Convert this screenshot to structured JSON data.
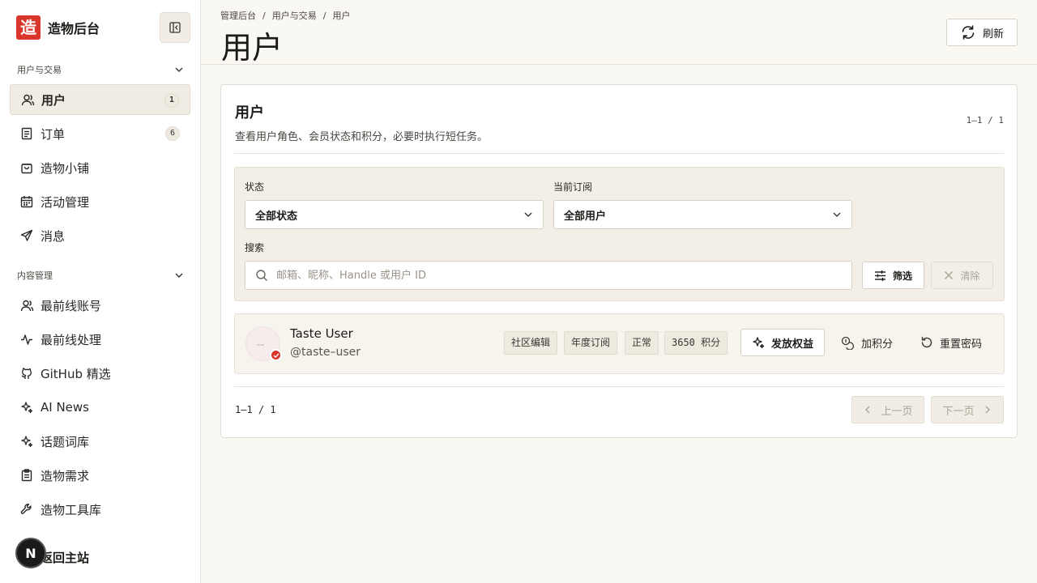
{
  "brand": {
    "logo_text": "造",
    "name": "造物后台"
  },
  "sidebar": {
    "sections": [
      {
        "label": "用户与交易"
      },
      {
        "label": "内容管理"
      }
    ],
    "items": [
      {
        "label": "用户",
        "badge": "1",
        "icon": "user-icon",
        "active": true
      },
      {
        "label": "订单",
        "badge": "6",
        "icon": "document-icon"
      },
      {
        "label": "造物小铺",
        "icon": "bag-icon"
      },
      {
        "label": "活动管理",
        "icon": "calendar-icon"
      },
      {
        "label": "消息",
        "icon": "send-icon"
      },
      {
        "label": "最前线账号",
        "icon": "user-icon"
      },
      {
        "label": "最前线处理",
        "icon": "activity-icon"
      },
      {
        "label": "GitHub 精选",
        "icon": "github-icon"
      },
      {
        "label": "AI News",
        "icon": "sparkle-icon"
      },
      {
        "label": "话题词库",
        "icon": "sparkle-icon"
      },
      {
        "label": "造物需求",
        "icon": "clipboard-icon"
      },
      {
        "label": "造物工具库",
        "icon": "wrench-icon"
      }
    ],
    "back_home": "返回主站",
    "dev_badge": "N"
  },
  "header": {
    "breadcrumb": [
      "管理后台",
      "用户与交易",
      "用户"
    ],
    "breadcrumb_sep": "/",
    "title": "用户",
    "refresh_label": "刷新"
  },
  "card": {
    "title": "用户",
    "subtitle": "查看用户角色、会员状态和积分，必要时执行短任务。",
    "range": "1–1 / 1"
  },
  "filters": {
    "status_label": "状态",
    "status_value": "全部状态",
    "sub_label": "当前订阅",
    "sub_value": "全部用户",
    "search_label": "搜索",
    "search_placeholder": "邮箱、昵称、Handle 或用户 ID",
    "filter_button": "筛选",
    "clear_button": "清除"
  },
  "users": [
    {
      "name": "Taste User",
      "handle": "@taste–user",
      "tags": [
        "社区编辑",
        "年度订阅",
        "正常",
        "3650 积分"
      ],
      "actions": {
        "grant": "发放权益",
        "add_points": "加积分",
        "reset_password": "重置密码"
      }
    }
  ],
  "pagination": {
    "range": "1–1 / 1",
    "prev": "上一页",
    "next": "下一页"
  },
  "colors": {
    "accent": "#d9362b",
    "background": "#faf8f3",
    "panel": "#f3efe7"
  }
}
